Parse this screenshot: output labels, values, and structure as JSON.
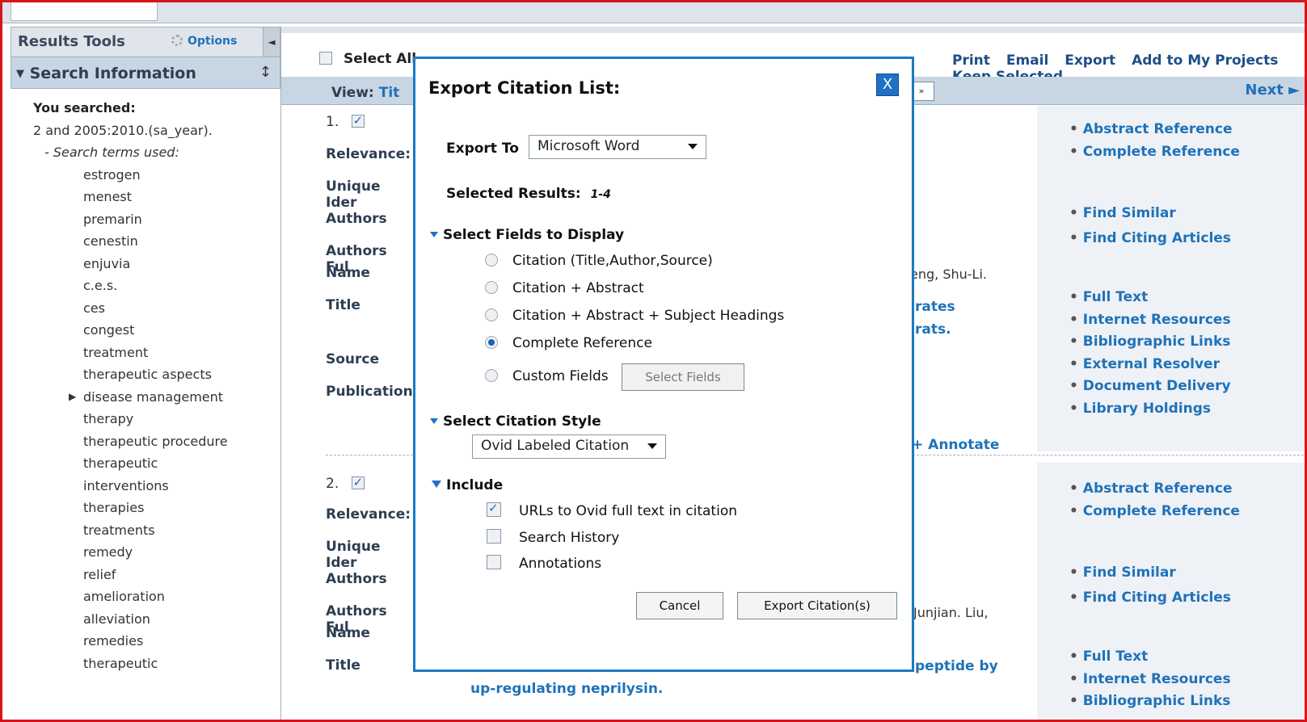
{
  "left": {
    "tools_title": "Results Tools",
    "options": "Options",
    "search_info_title": "Search Information",
    "you_searched": "You searched:",
    "query": "2 and 2005:2010.(sa_year).",
    "terms_label": "- Search terms used:",
    "terms": [
      "estrogen",
      "menest",
      "premarin",
      "cenestin",
      "enjuvia",
      "c.e.s.",
      "ces",
      "congest",
      "treatment",
      "therapeutic aspects",
      "disease management",
      "therapy",
      "therapeutic procedure",
      "therapeutic",
      "interventions",
      "therapies",
      "treatments",
      "remedy",
      "relief",
      "amelioration",
      "alleviation",
      "remedies",
      "therapeutic"
    ]
  },
  "toolbar": {
    "select_all": "Select All",
    "print": "Print",
    "email": "Email",
    "export": "Export",
    "add_projects": "Add to My Projects",
    "keep_selected": "Keep Selected"
  },
  "viewbar": {
    "view": "View:",
    "view_value": "Tit",
    "next": "Next ►"
  },
  "records": [
    {
      "num": "1.",
      "labels": [
        "Relevance:",
        "Unique Ider",
        "Authors",
        "Authors Ful",
        "Name",
        "Title",
        "Source",
        "Publication"
      ],
      "frag_author": "eng, Shu-Li.",
      "frag_title1": "rates",
      "frag_title2": "rats.",
      "annotate": "+ Annotate",
      "links1": [
        "Abstract Reference",
        "Complete Reference"
      ],
      "links2": [
        "Find Similar",
        "Find Citing Articles"
      ],
      "links3": [
        "Full Text",
        "Internet Resources",
        "Bibliographic Links",
        "External Resolver",
        "Document Delivery",
        "Library Holdings"
      ]
    },
    {
      "num": "2.",
      "labels": [
        "Relevance:",
        "Unique Ider",
        "Authors",
        "Authors Ful",
        "Name",
        "Title"
      ],
      "frag_author": "Junjian. Liu,",
      "frag_title1": "peptide by",
      "frag_title2": "up-regulating neprilysin.",
      "links1": [
        "Abstract Reference",
        "Complete Reference"
      ],
      "links2": [
        "Find Similar",
        "Find Citing Articles"
      ],
      "links3": [
        "Full Text",
        "Internet Resources",
        "Bibliographic Links"
      ]
    }
  ],
  "modal": {
    "title": "Export Citation List:",
    "close": "X",
    "export_to_label": "Export To",
    "export_to_value": "Microsoft Word",
    "selected_label": "Selected Results:",
    "selected_value": "1-4",
    "fields_header": "Select Fields to Display",
    "field_options": [
      "Citation (Title,Author,Source)",
      "Citation + Abstract",
      "Citation + Abstract + Subject Headings",
      "Complete Reference",
      "Custom Fields"
    ],
    "select_fields_btn": "Select Fields",
    "style_header": "Select Citation Style",
    "style_value": "Ovid Labeled Citation",
    "include_header": "Include",
    "include_options": [
      "URLs to Ovid full text in citation",
      "Search History",
      "Annotations"
    ],
    "cancel": "Cancel",
    "export_btn": "Export Citation(s)"
  }
}
